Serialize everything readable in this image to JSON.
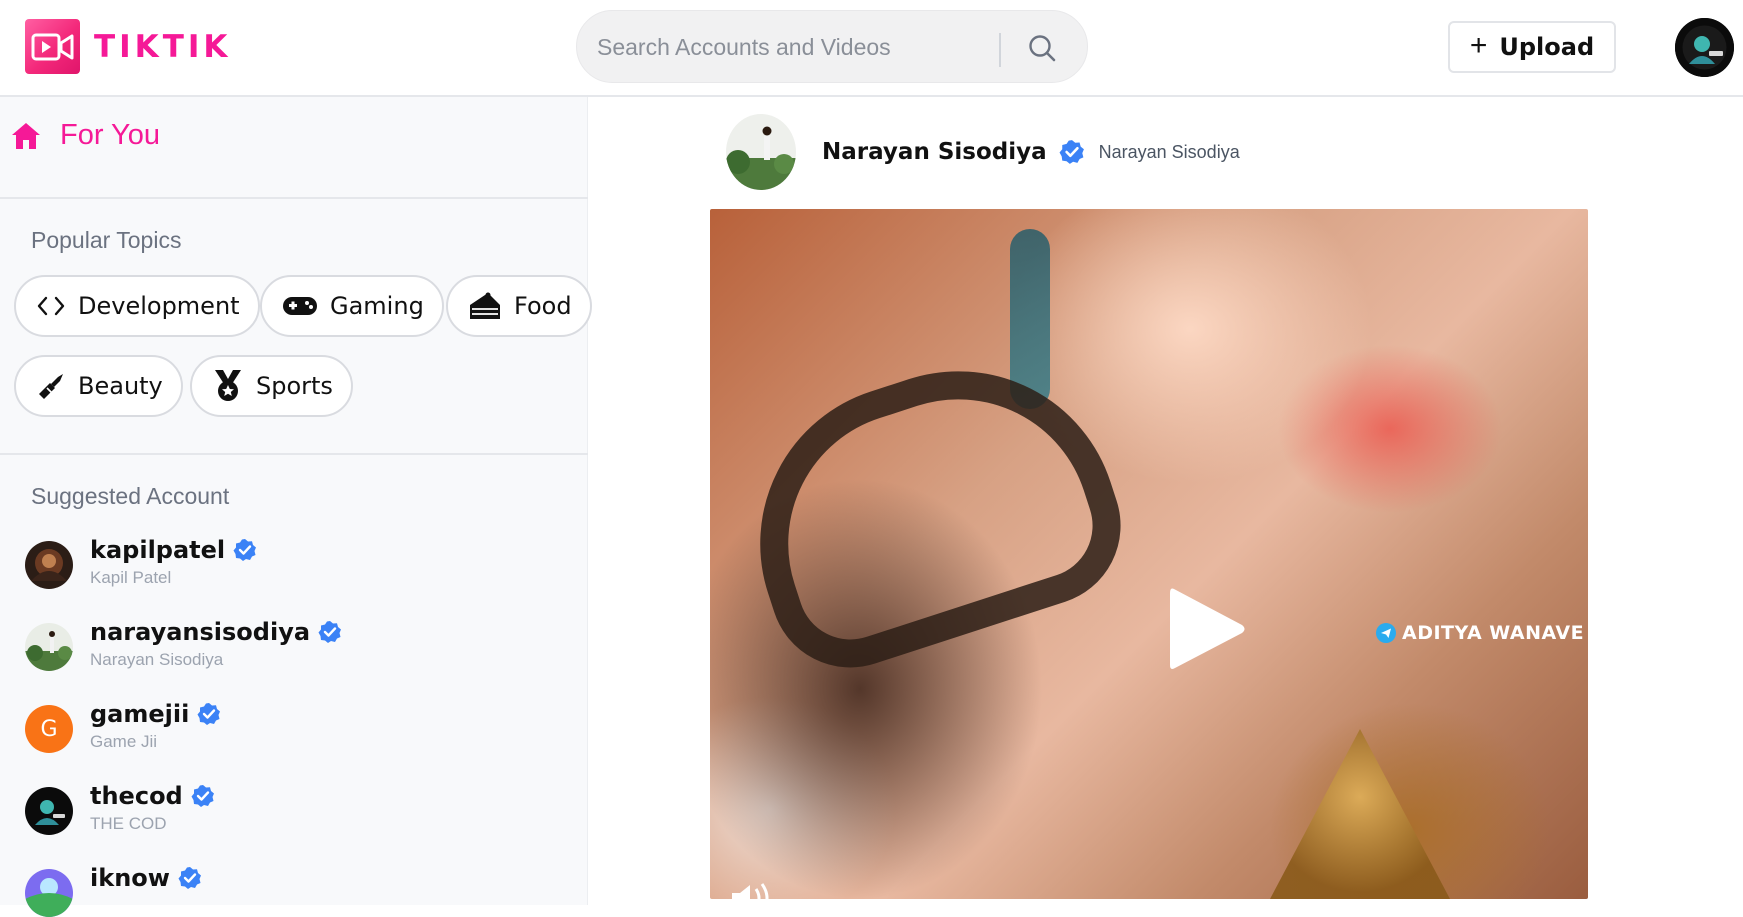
{
  "app": {
    "name": "TIKTIK",
    "brand_color": "#f51997"
  },
  "header": {
    "search": {
      "placeholder": "Search Accounts and Videos",
      "icon": "search-icon"
    },
    "upload_label": "Upload",
    "upload_icon": "plus-icon"
  },
  "sidebar": {
    "for_you": {
      "label": "For You",
      "icon": "home-icon"
    },
    "popular_topics_title": "Popular Topics",
    "topics": [
      {
        "label": "Development",
        "icon": "code-icon"
      },
      {
        "label": "Gaming",
        "icon": "gamepad-icon"
      },
      {
        "label": "Food",
        "icon": "cake-icon"
      },
      {
        "label": "Beauty",
        "icon": "lipstick-icon"
      },
      {
        "label": "Sports",
        "icon": "medal-icon"
      }
    ],
    "suggested_title": "Suggested Account",
    "accounts": [
      {
        "handle": "kapilpatel",
        "name": "Kapil Patel",
        "verified": true
      },
      {
        "handle": "narayansisodiya",
        "name": "Narayan Sisodiya",
        "verified": true
      },
      {
        "handle": "gamejii",
        "name": "Game Jii",
        "verified": true,
        "initial": "G"
      },
      {
        "handle": "thecod",
        "name": "THE COD",
        "verified": true
      },
      {
        "handle": "iknow",
        "name": "",
        "verified": true
      }
    ]
  },
  "post": {
    "author_handle": "Narayan Sisodiya",
    "author_name": "Narayan Sisodiya",
    "verified": true,
    "video": {
      "watermark": "ADITYA  WANAVE",
      "play_icon": "play-icon",
      "mute_icon": "volume-icon"
    }
  },
  "colors": {
    "verified": "#3b82f6",
    "avatar_g": "#f97316"
  }
}
